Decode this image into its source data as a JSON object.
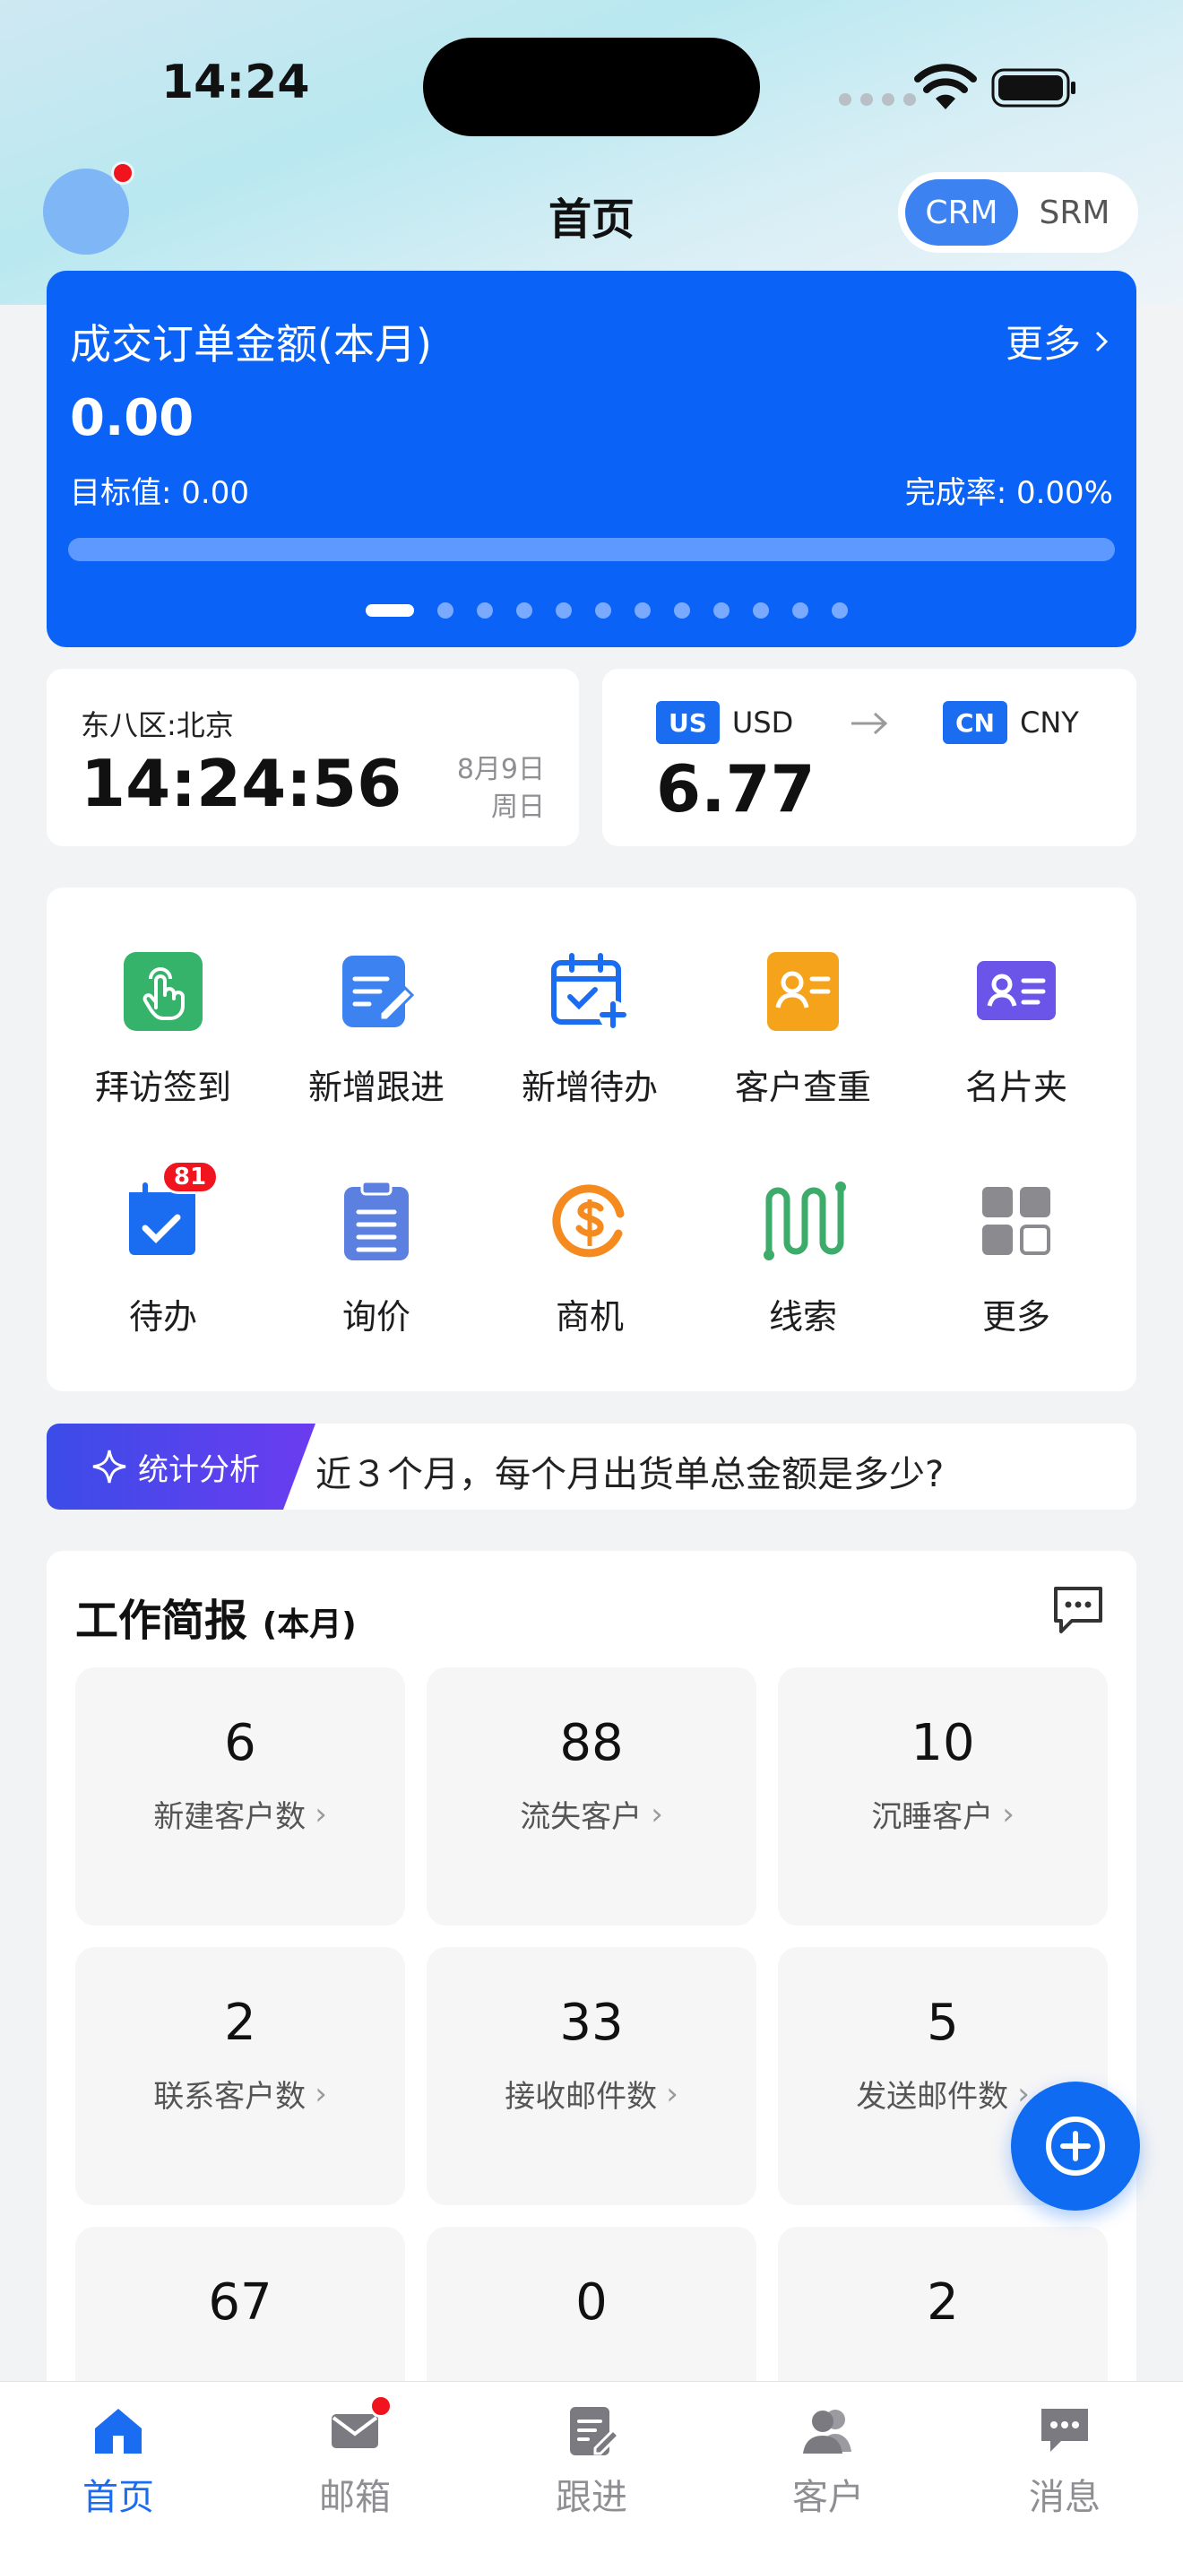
{
  "status_bar": {
    "time": "14:24"
  },
  "header": {
    "title": "首页",
    "segments": [
      "CRM",
      "SRM"
    ],
    "active_segment": "CRM"
  },
  "banner": {
    "title": "成交订单金额(本月)",
    "more": "更多",
    "value": "0.00",
    "target": "目标值: 0.00",
    "rate": "完成率: 0.00%",
    "progress_percent": 0,
    "page_count": 12,
    "active_page": 0
  },
  "clock": {
    "timezone": "东八区:北京",
    "time": "14:24:56",
    "date": "8月9日",
    "weekday": "周日"
  },
  "exchange": {
    "from_badge": "US",
    "from_code": "USD",
    "to_badge": "CN",
    "to_code": "CNY",
    "rate": "6.77"
  },
  "apps": [
    {
      "label": "拜访签到",
      "icon": "hand-tap-icon",
      "color": "#35b36a"
    },
    {
      "label": "新增跟进",
      "icon": "edit-note-icon",
      "color": "#3d82f1"
    },
    {
      "label": "新增待办",
      "icon": "calendar-add-icon",
      "color": "#1a6cf0"
    },
    {
      "label": "客户查重",
      "icon": "contact-card-icon",
      "color": "#f5a31a"
    },
    {
      "label": "名片夹",
      "icon": "business-card-icon",
      "color": "#6a55e8"
    },
    {
      "label": "待办",
      "icon": "calendar-check-icon",
      "color": "#1a6cf0",
      "badge": "81"
    },
    {
      "label": "询价",
      "icon": "clipboard-icon",
      "color": "#5b80e0"
    },
    {
      "label": "商机",
      "icon": "opportunity-icon",
      "color": "#f58a1f"
    },
    {
      "label": "线索",
      "icon": "leads-icon",
      "color": "#3dab6a"
    },
    {
      "label": "更多",
      "icon": "grid-more-icon",
      "color": "#8a8a8f"
    }
  ],
  "analysis": {
    "tag": "统计分析",
    "question": "近３个月，每个月出货单总金额是多少?"
  },
  "report": {
    "title": "工作简报",
    "subtitle": "(本月)",
    "stats": [
      {
        "value": "6",
        "label": "新建客户数"
      },
      {
        "value": "88",
        "label": "流失客户"
      },
      {
        "value": "10",
        "label": "沉睡客户"
      },
      {
        "value": "2",
        "label": "联系客户数"
      },
      {
        "value": "33",
        "label": "接收邮件数"
      },
      {
        "value": "5",
        "label": "发送邮件数"
      },
      {
        "value": "67",
        "label": ""
      },
      {
        "value": "0",
        "label": ""
      },
      {
        "value": "2",
        "label": ""
      }
    ]
  },
  "tabs": [
    {
      "label": "首页",
      "icon": "home-icon",
      "active": true
    },
    {
      "label": "邮箱",
      "icon": "mail-icon",
      "dot": true
    },
    {
      "label": "跟进",
      "icon": "followup-icon"
    },
    {
      "label": "客户",
      "icon": "customers-icon"
    },
    {
      "label": "消息",
      "icon": "message-icon"
    }
  ],
  "colors": {
    "primary": "#0b62f6",
    "accent": "#1a6cf0",
    "badge": "#f0141e"
  }
}
